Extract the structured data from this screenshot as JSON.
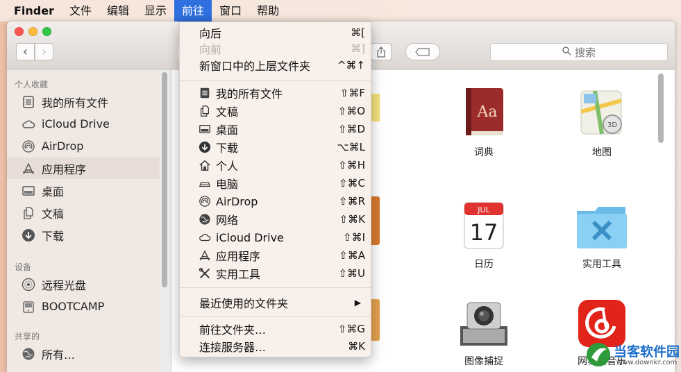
{
  "menubar": {
    "app": "Finder",
    "items": [
      "文件",
      "编辑",
      "显示",
      "前往",
      "窗口",
      "帮助"
    ],
    "active_index": 3
  },
  "toolbar": {
    "search_placeholder": "搜索",
    "icons": [
      "back-icon",
      "forward-icon",
      "share-icon",
      "tag-icon",
      "search-icon"
    ]
  },
  "sidebar": {
    "favorites_header": "个人收藏",
    "favorites": [
      {
        "label": "我的所有文件",
        "icon": "all-files-icon"
      },
      {
        "label": "iCloud Drive",
        "icon": "cloud-icon"
      },
      {
        "label": "AirDrop",
        "icon": "airdrop-icon"
      },
      {
        "label": "应用程序",
        "icon": "applications-icon"
      },
      {
        "label": "桌面",
        "icon": "desktop-icon"
      },
      {
        "label": "文稿",
        "icon": "documents-icon"
      },
      {
        "label": "下载",
        "icon": "downloads-icon"
      }
    ],
    "devices_header": "设备",
    "devices": [
      {
        "label": "远程光盘",
        "icon": "disc-icon"
      },
      {
        "label": "BOOTCAMP",
        "icon": "drive-icon"
      }
    ],
    "shared_header": "共享的",
    "shared": [
      {
        "label": "所有…",
        "icon": "network-icon"
      }
    ]
  },
  "content": {
    "apps": [
      {
        "label": "词典",
        "icon": "dictionary-app-icon"
      },
      {
        "label": "地图",
        "icon": "maps-app-icon"
      },
      {
        "label": "日历",
        "icon": "calendar-app-icon",
        "cal_month": "JUL",
        "cal_day": "17"
      },
      {
        "label": "实用工具",
        "icon": "utilities-folder-icon"
      },
      {
        "label": "图像捕捉",
        "icon": "image-capture-app-icon"
      },
      {
        "label": "网易云音乐",
        "icon": "netease-music-app-icon"
      }
    ]
  },
  "go_menu": {
    "items": [
      {
        "label": "向后",
        "shortcut": "⌘[",
        "enabled": true
      },
      {
        "label": "向前",
        "shortcut": "⌘]",
        "enabled": false
      },
      {
        "label": "新窗口中的上层文件夹",
        "shortcut": "^⌘↑",
        "enabled": true
      },
      {
        "label": "我的所有文件",
        "shortcut": "⇧⌘F",
        "icon": "all-files-icon"
      },
      {
        "label": "文稿",
        "shortcut": "⇧⌘O",
        "icon": "documents-icon"
      },
      {
        "label": "桌面",
        "shortcut": "⇧⌘D",
        "icon": "desktop-icon"
      },
      {
        "label": "下载",
        "shortcut": "⌥⌘L",
        "icon": "downloads-icon"
      },
      {
        "label": "个人",
        "shortcut": "⇧⌘H",
        "icon": "home-icon"
      },
      {
        "label": "电脑",
        "shortcut": "⇧⌘C",
        "icon": "computer-icon"
      },
      {
        "label": "AirDrop",
        "shortcut": "⇧⌘R",
        "icon": "airdrop-icon"
      },
      {
        "label": "网络",
        "shortcut": "⇧⌘K",
        "icon": "network-icon"
      },
      {
        "label": "iCloud Drive",
        "shortcut": "⇧⌘I",
        "icon": "cloud-icon"
      },
      {
        "label": "应用程序",
        "shortcut": "⇧⌘A",
        "icon": "applications-icon"
      },
      {
        "label": "实用工具",
        "shortcut": "⇧⌘U",
        "icon": "utilities-icon"
      },
      {
        "label": "最近使用的文件夹",
        "shortcut": "▶"
      },
      {
        "label": "前往文件夹…",
        "shortcut": "⇧⌘G"
      },
      {
        "label": "连接服务器…",
        "shortcut": "⌘K"
      }
    ]
  },
  "watermark": {
    "name": "当客软件园",
    "url": "www.downkr.com"
  },
  "colors": {
    "menu_highlight": "#2f6fde",
    "sidebar_bg": "#f0e8e3",
    "window_bg": "#ececec"
  }
}
